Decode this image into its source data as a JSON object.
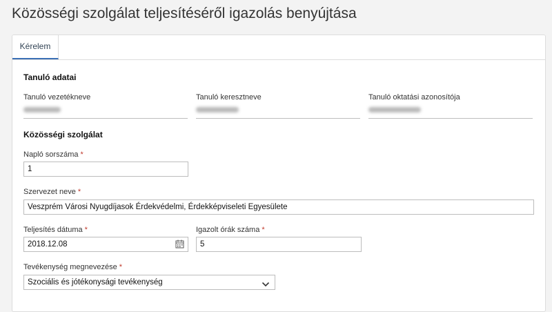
{
  "page": {
    "title": "Közösségi szolgálat teljesítéséről igazolás benyújtása"
  },
  "tabs": [
    {
      "label": "Kérelem",
      "active": true
    }
  ],
  "student_section": {
    "title": "Tanuló adatai",
    "fields": [
      {
        "label": "Tanuló vezetékneve"
      },
      {
        "label": "Tanuló keresztneve"
      },
      {
        "label": "Tanuló oktatási azonosítója"
      }
    ]
  },
  "service_section": {
    "title": "Közösségi szolgálat",
    "journal_number": {
      "label": "Napló sorszáma",
      "required": "*",
      "value": "1"
    },
    "organization": {
      "label": "Szervezet neve",
      "required": "*",
      "value": "Veszprém Városi Nyugdíjasok Érdekvédelmi, Érdekképviseleti Egyesülete"
    },
    "completion_date": {
      "label": "Teljesítés dátuma",
      "required": "*",
      "value": "2018.12.08",
      "icon": "calendar-icon"
    },
    "certified_hours": {
      "label": "Igazolt órák száma",
      "required": "*",
      "value": "5"
    },
    "activity": {
      "label": "Tevékenység megnevezése",
      "required": "*",
      "value": "Szociális és jótékonysági tevékenység",
      "icon": "chevron-down-icon"
    }
  },
  "colors": {
    "accent": "#3a6fb5",
    "required": "#c0392b",
    "border": "#bcbcbc"
  }
}
